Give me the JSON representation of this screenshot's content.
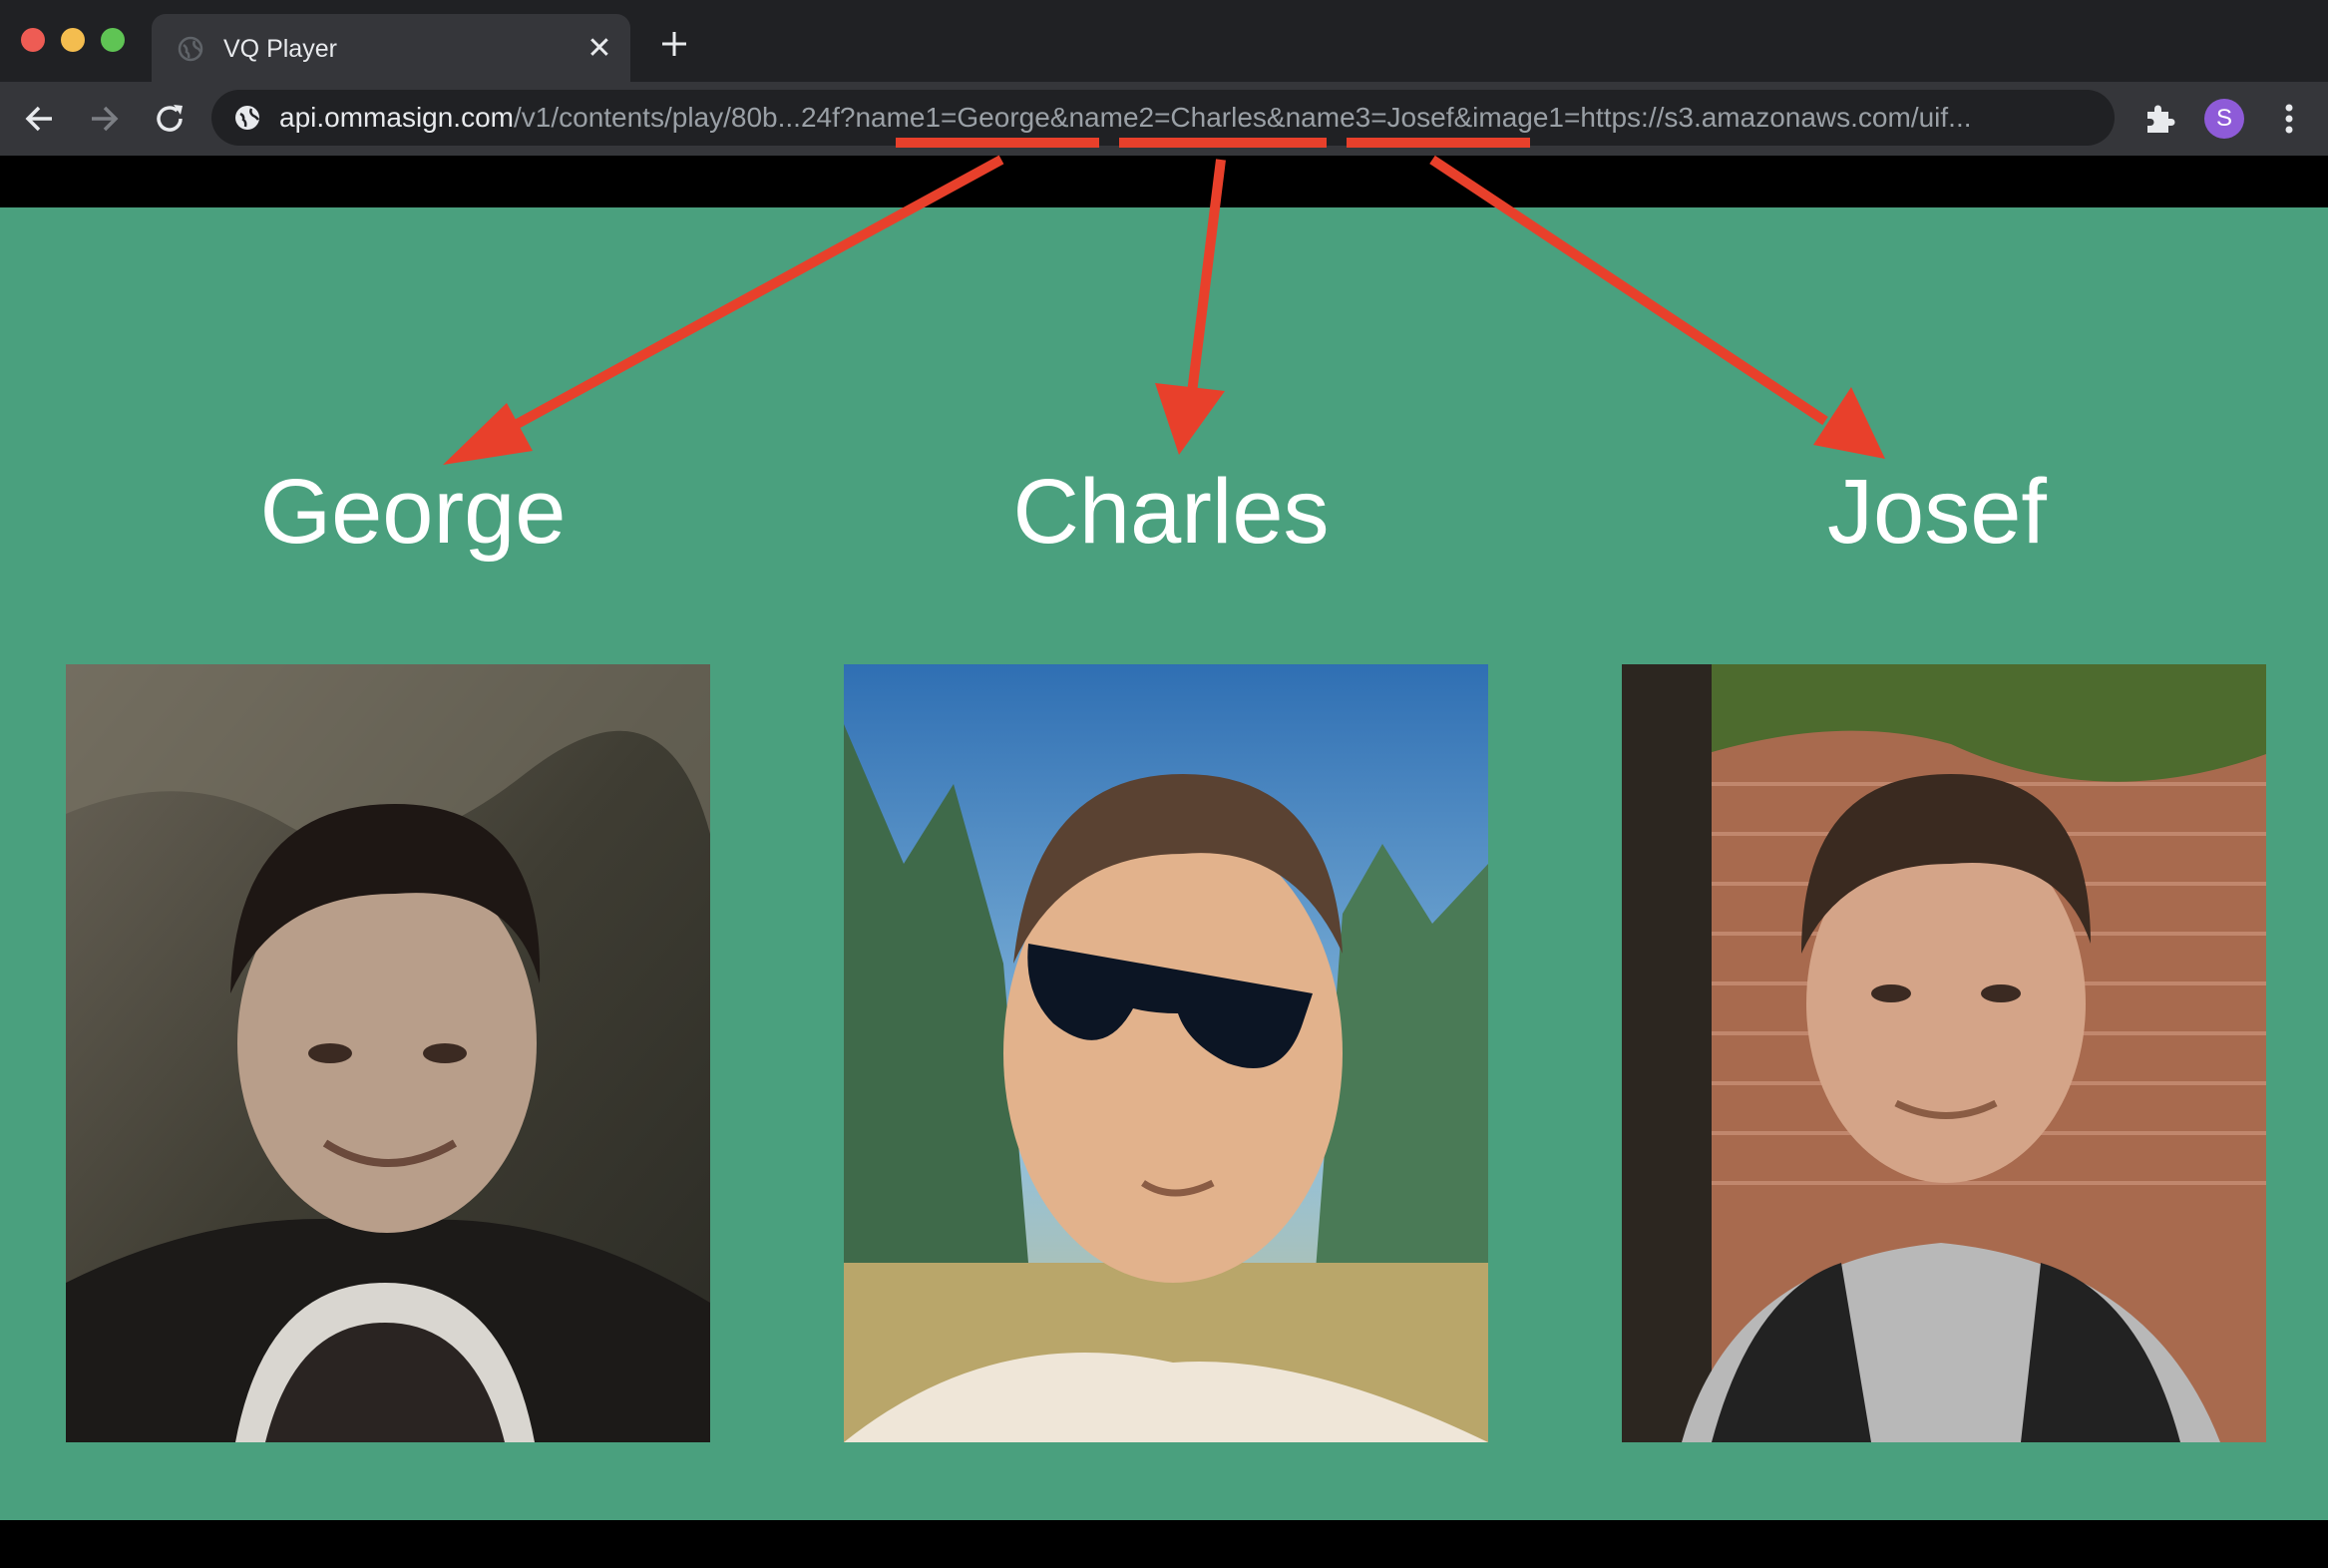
{
  "browser": {
    "tab_title": "VQ Player",
    "tab_close": "✕",
    "url_host": "api.ommasign.com",
    "url_rest": "/v1/contents/play/80b...24f?name1=George&name2=Charles&name3=Josef&image1=https://s3.amazonaws.com/uif...",
    "profile_initial": "S"
  },
  "people": [
    {
      "name": "George"
    },
    {
      "name": "Charles"
    },
    {
      "name": "Josef"
    }
  ],
  "colors": {
    "page_background": "#4aa07e",
    "annotation": "#e8402b",
    "browser_chrome": "#35363a"
  },
  "icons": [
    "globe-icon",
    "close-icon",
    "plus-icon",
    "back-arrow-icon",
    "forward-arrow-icon",
    "reload-icon",
    "site-info-icon",
    "puzzle-icon",
    "kebab-menu-icon"
  ]
}
